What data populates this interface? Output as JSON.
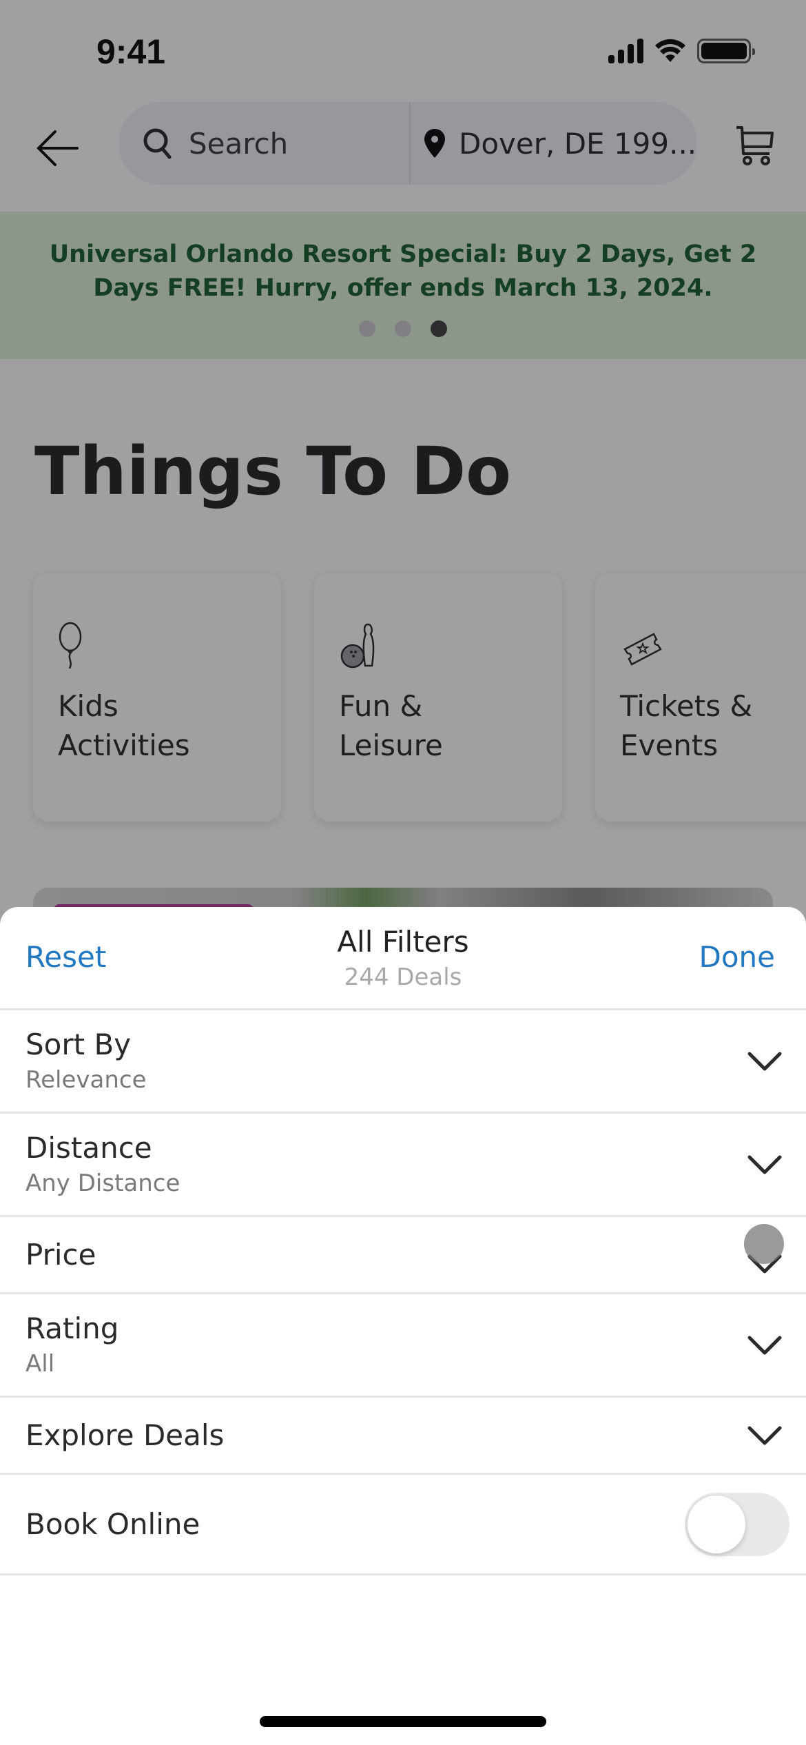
{
  "status_bar": {
    "time": "9:41"
  },
  "nav": {
    "search_placeholder": "Search",
    "location": "Dover, DE 199..."
  },
  "promo": {
    "text": "Universal Orlando Resort Special: Buy 2 Days, Get 2 Days FREE! Hurry, offer ends March 13, 2024.",
    "page_count": 3,
    "active_page": 3
  },
  "page": {
    "title": "Things To Do",
    "categories": [
      {
        "label": "Kids\nActivities",
        "icon": "balloon-icon"
      },
      {
        "label": "Fun &\nLeisure",
        "icon": "bowling-icon"
      },
      {
        "label": "Tickets &\nEvents",
        "icon": "ticket-icon"
      }
    ]
  },
  "sheet": {
    "title": "All Filters",
    "count": "244 Deals",
    "reset_label": "Reset",
    "done_label": "Done",
    "filters": [
      {
        "label": "Sort By",
        "value": "Relevance"
      },
      {
        "label": "Distance",
        "value": "Any Distance"
      },
      {
        "label": "Price",
        "value": null
      },
      {
        "label": "Rating",
        "value": "All"
      },
      {
        "label": "Explore Deals",
        "value": null
      }
    ],
    "book_online": {
      "label": "Book Online",
      "enabled": false
    }
  },
  "colors": {
    "accent": "#1f78c1",
    "promo_bg": "#dcefd9",
    "promo_text": "#0f5a2a"
  }
}
